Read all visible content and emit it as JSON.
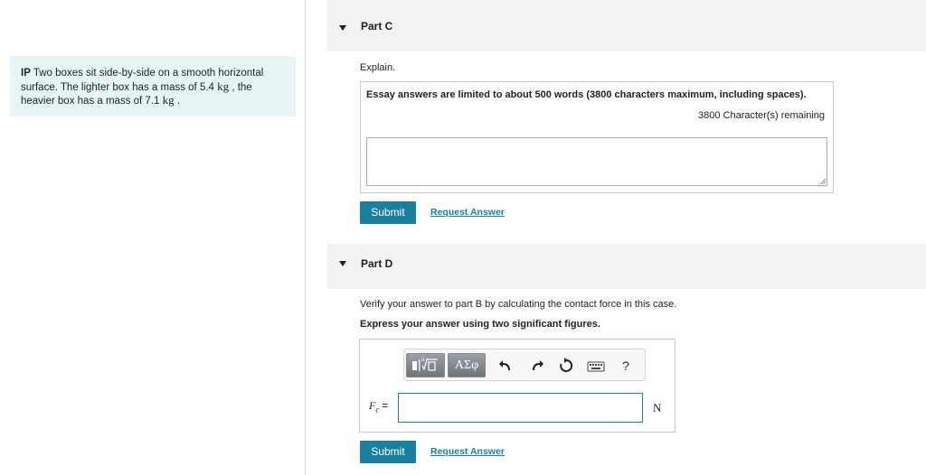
{
  "problem": {
    "prefix": "IP",
    "text_part1": " Two boxes sit side-by-side on a smooth horizontal surface. The lighter box has a mass of 5.4 ",
    "unit1": "kg",
    "text_part2": " , the heavier box has a mass of 7.1 ",
    "unit2": "kg",
    "text_part3": " ."
  },
  "part_c": {
    "title": "Part C",
    "explain_label": "Explain.",
    "essay_limit": "Essay answers are limited to about 500 words (3800 characters maximum, including spaces).",
    "remaining": "3800 Character(s) remaining",
    "submit_label": "Submit",
    "request_label": "Request Answer"
  },
  "part_d": {
    "title": "Part D",
    "verify_text": "Verify your answer to part B by calculating the contact force in this case.",
    "express_text": "Express your answer using two significant figures.",
    "toolbar": {
      "greek_label": "ΑΣφ",
      "help_label": "?"
    },
    "variable": "F",
    "variable_sub": "c",
    "equals": "=",
    "unit": "N",
    "submit_label": "Submit",
    "request_label": "Request Answer"
  },
  "colors": {
    "accent": "#1b7fa0",
    "problem_bg": "#e8f5f7",
    "header_bg": "#f2f2f2"
  }
}
